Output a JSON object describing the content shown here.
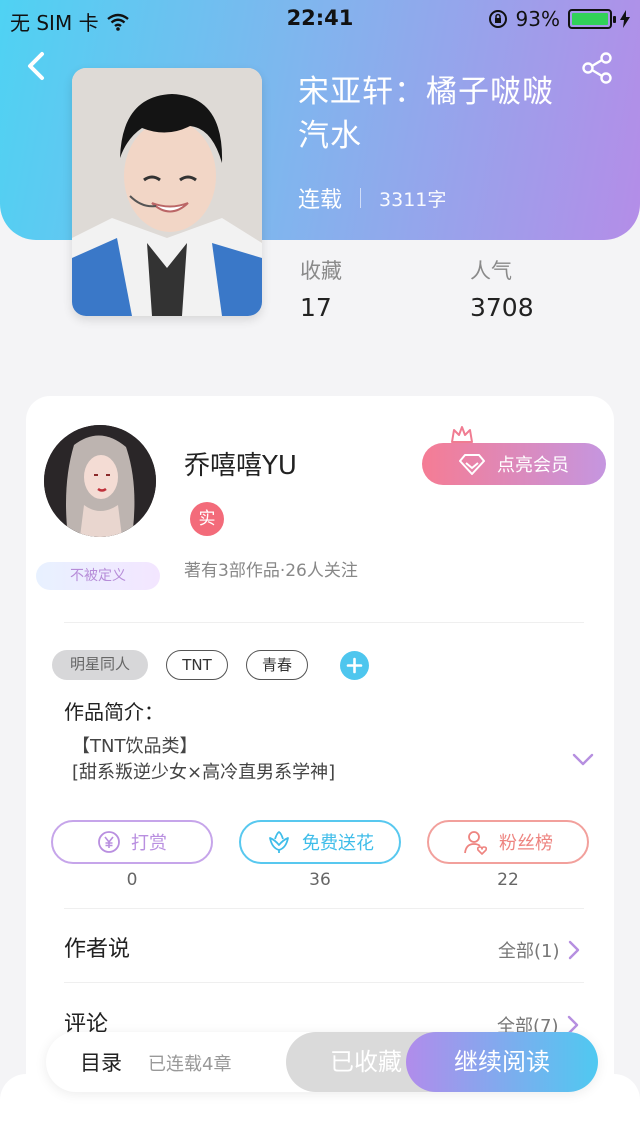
{
  "status_bar": {
    "carrier": "无 SIM 卡",
    "time": "22:41",
    "battery": "93%"
  },
  "book": {
    "title_line1": "宋亚轩：橘子啵啵",
    "title_line2": "汽水",
    "status": "连载",
    "word_count": "3311字",
    "stats": [
      {
        "label": "收藏",
        "value": "17"
      },
      {
        "label": "人气",
        "value": "3708"
      }
    ]
  },
  "author": {
    "name": "乔嘻嘻YU",
    "verified_badge": "实",
    "decor_tag": "不被定义",
    "info": "著有3部作品·26人关注",
    "vip_button": "点亮会员"
  },
  "tags": [
    "明星同人",
    "TNT",
    "青春"
  ],
  "intro": {
    "label": "作品简介：",
    "line1": "【TNT饮品类】",
    "line2": "[甜系叛逆少女×高冷直男系学神]"
  },
  "actions": [
    {
      "label": "打赏",
      "count": "0",
      "icon": "yen-coin-icon",
      "color": "#b98fe0"
    },
    {
      "label": "免费送花",
      "count": "36",
      "icon": "flower-icon",
      "color": "#46c3ee"
    },
    {
      "label": "粉丝榜",
      "count": "22",
      "icon": "fan-user-icon",
      "color": "#f08a86"
    }
  ],
  "sections": {
    "author_says": {
      "label": "作者说",
      "more": "全部(1)"
    },
    "comments": {
      "label": "评论",
      "more": "全部(7)"
    }
  },
  "bottom_bar": {
    "toc_label": "目录",
    "toc_count": "已连载4章",
    "favorited": "已收藏",
    "continue_reading": "继续阅读"
  },
  "colors": {
    "header_gradient_start": "#4fd2f3",
    "header_gradient_end": "#b48de8",
    "accent_purple": "#b18ceb",
    "accent_blue": "#4fc9f1"
  }
}
